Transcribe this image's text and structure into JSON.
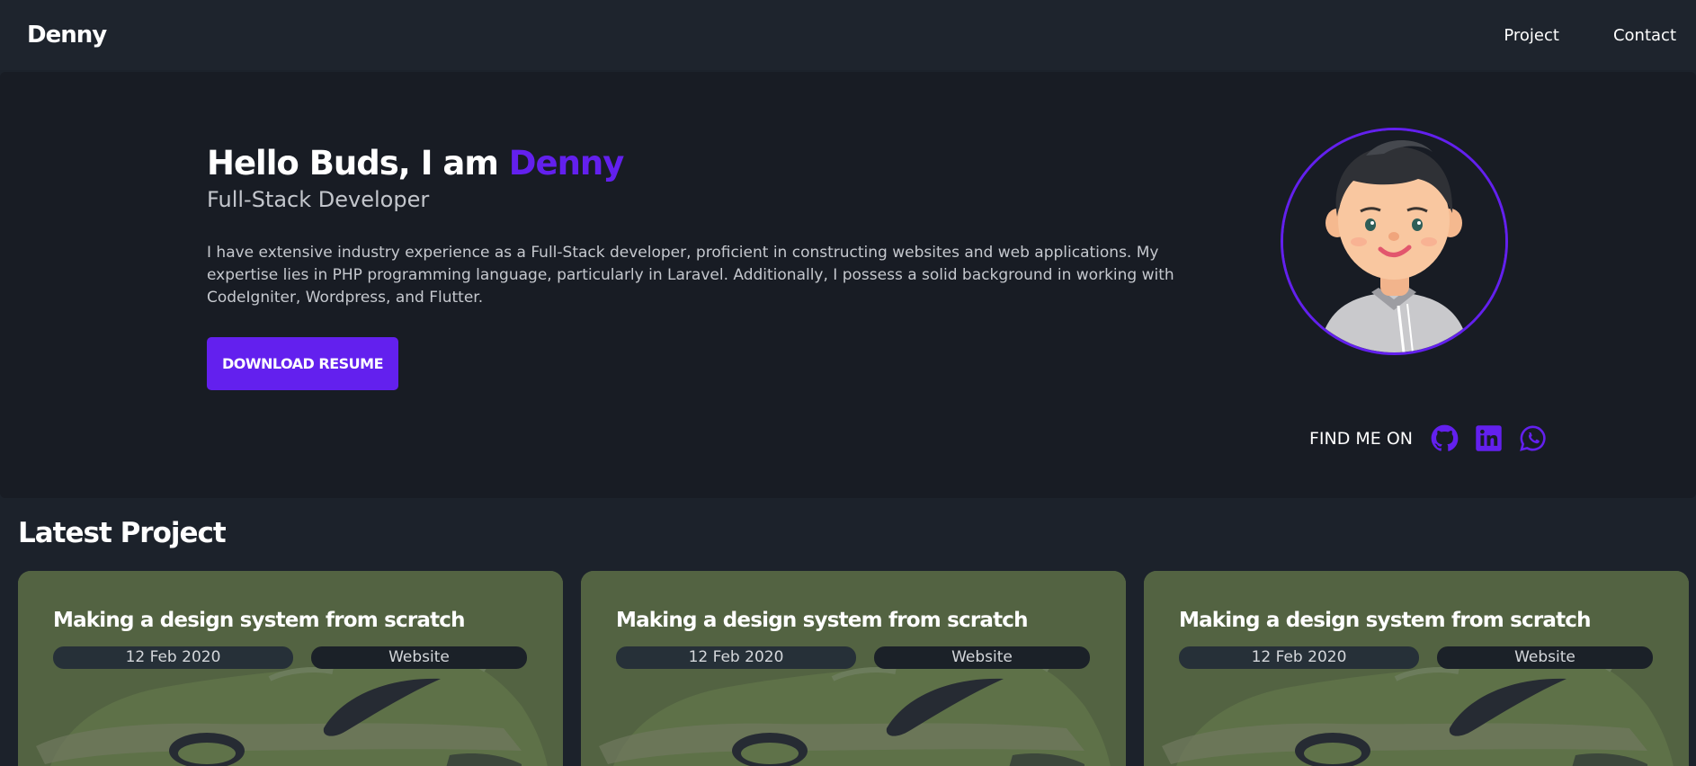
{
  "navbar": {
    "brand": "Denny",
    "links": [
      "Project",
      "Contact"
    ]
  },
  "hero": {
    "greeting": "Hello Buds, I am ",
    "name": "Denny",
    "subtitle": "Full-Stack Developer",
    "description": "I have extensive industry experience as a Full-Stack developer, proficient in constructing websites and web applications. My expertise lies in PHP programming language, particularly in Laravel. Additionally, I possess a solid background in working with CodeIgniter, Wordpress, and Flutter.",
    "resume_button": "DOWNLOAD RESUME",
    "find_me_label": "FIND ME ON",
    "socials": [
      "github-icon",
      "linkedin-icon",
      "whatsapp-icon"
    ]
  },
  "projects": {
    "section_title": "Latest Project",
    "items": [
      {
        "title": "Making a design system from scratch",
        "date": "12 Feb 2020",
        "type": "Website"
      },
      {
        "title": "Making a design system from scratch",
        "date": "12 Feb 2020",
        "type": "Website"
      },
      {
        "title": "Making a design system from scratch",
        "date": "12 Feb 2020",
        "type": "Website"
      }
    ]
  },
  "colors": {
    "accent": "#6320ee",
    "background": "#1c222b",
    "hero_background": "#181c24",
    "card_background": "#536342"
  }
}
